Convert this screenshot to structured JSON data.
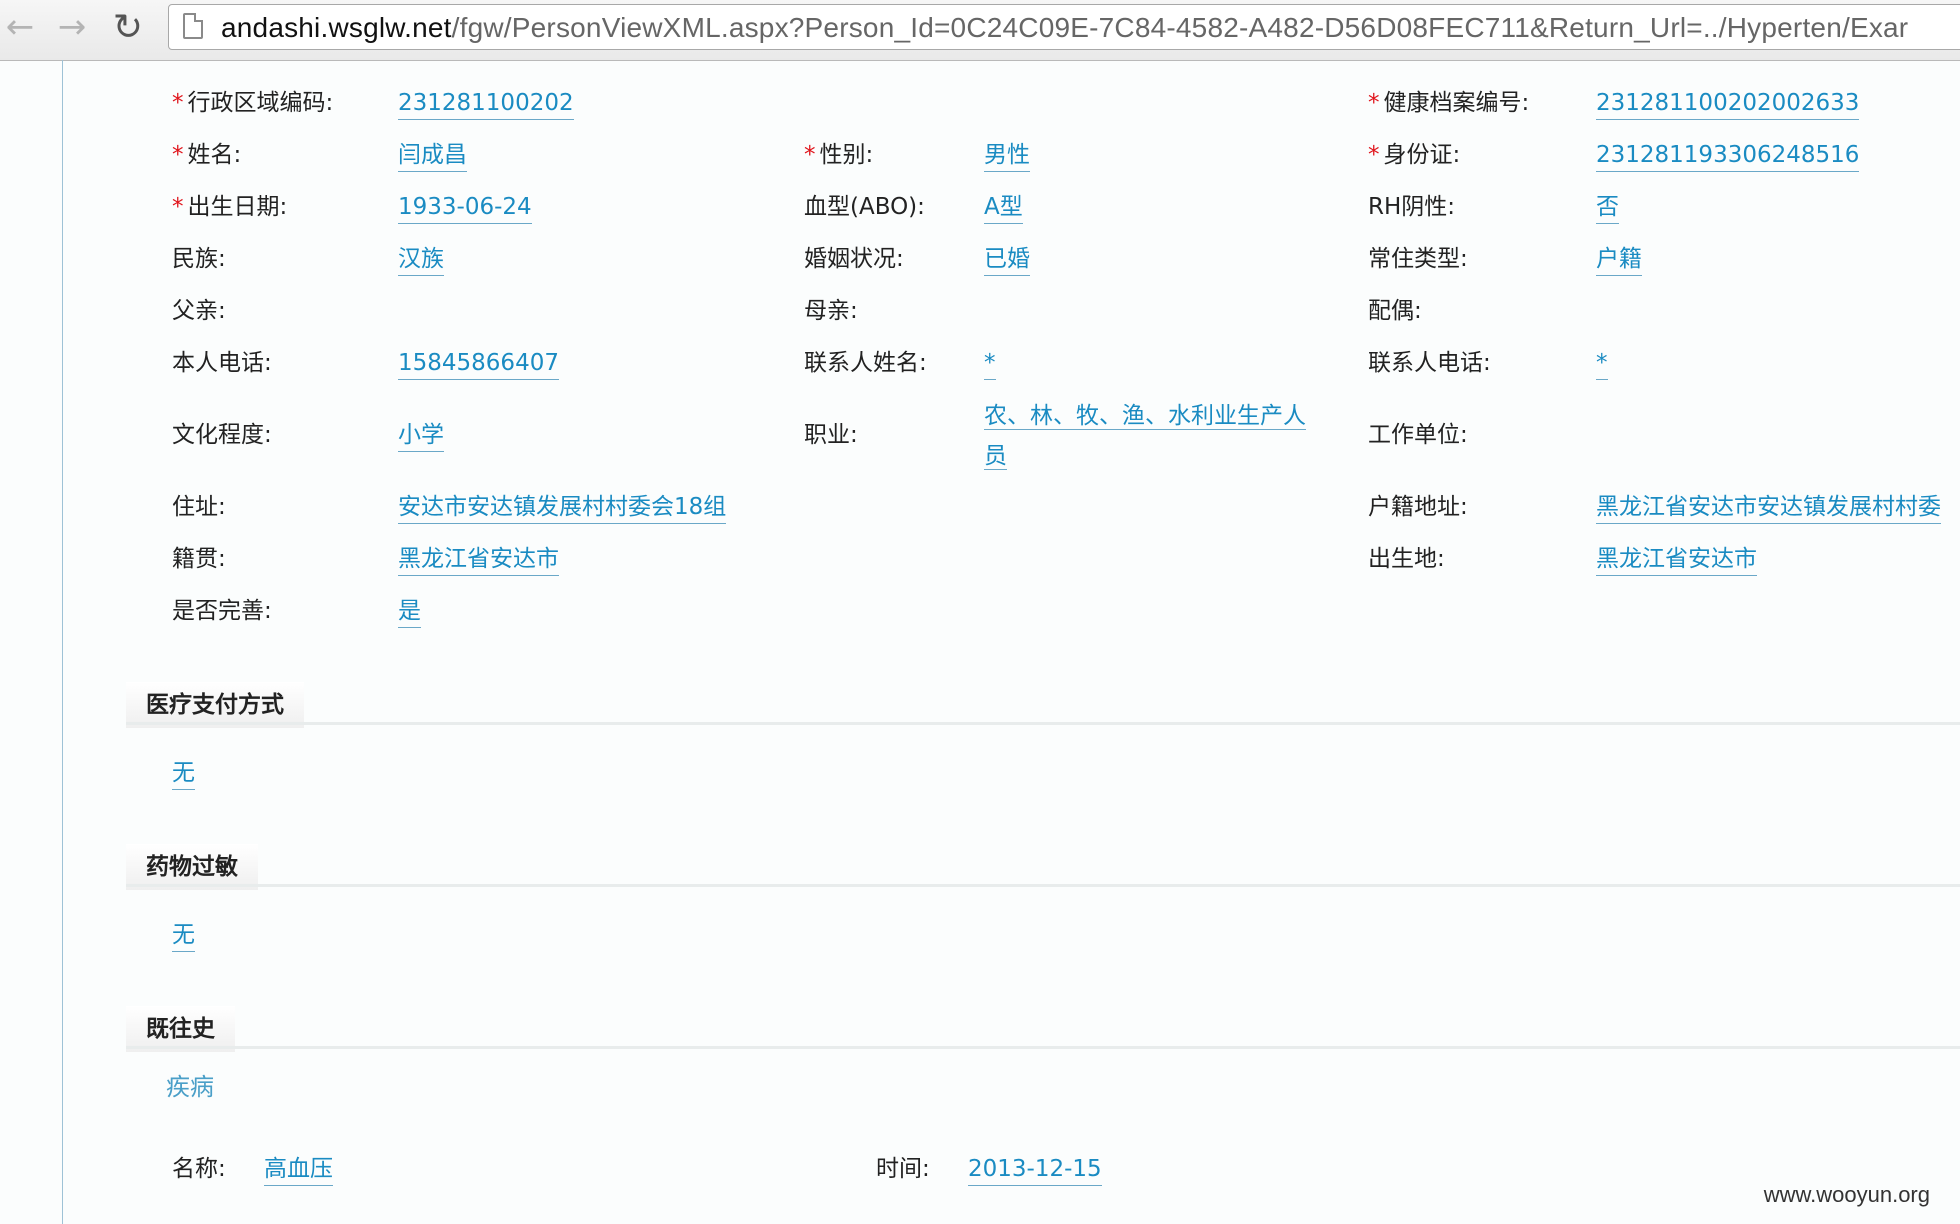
{
  "browser": {
    "url_host": "andashi.wsglw.net",
    "url_path": "/fgw/PersonViewXML.aspx?Person_Id=0C24C09E-7C84-4582-A482-D56D08FEC711&Return_Url=../Hyperten/Exar"
  },
  "person": {
    "region_code_label": "行政区域编码:",
    "region_code": "231281100202",
    "health_record_label": "健康档案编号:",
    "health_record": "231281100202002633",
    "name_label": "姓名:",
    "name": "闫成昌",
    "gender_label": "性别:",
    "gender": "男性",
    "id_card_label": "身份证:",
    "id_card": "231281193306248516",
    "birth_label": "出生日期:",
    "birth": "1933-06-24",
    "blood_label": "血型(ABO):",
    "blood": "A型",
    "rh_label": "RH阴性:",
    "rh": "否",
    "ethnic_label": "民族:",
    "ethnic": "汉族",
    "marital_label": "婚姻状况:",
    "marital": "已婚",
    "residence_type_label": "常住类型:",
    "residence_type": "户籍",
    "father_label": "父亲:",
    "mother_label": "母亲:",
    "spouse_label": "配偶:",
    "phone_label": "本人电话:",
    "phone": "15845866407",
    "contact_name_label": "联系人姓名:",
    "contact_name": "*",
    "contact_phone_label": "联系人电话:",
    "contact_phone": "*",
    "education_label": "文化程度:",
    "education": "小学",
    "occupation_label": "职业:",
    "occupation": "农、林、牧、渔、水利业生产人员",
    "workplace_label": "工作单位:",
    "address_label": "住址:",
    "address": "安达市安达镇发展村村委会18组",
    "household_address_label": "户籍地址:",
    "household_address": "黑龙江省安达市安达镇发展村村委",
    "native_place_label": "籍贯:",
    "native_place": "黑龙江省安达市",
    "birthplace_label": "出生地:",
    "birthplace": "黑龙江省安达市",
    "complete_label": "是否完善:",
    "complete": "是"
  },
  "sections": {
    "payment_title": "医疗支付方式",
    "payment_value": "无",
    "allergy_title": "药物过敏",
    "allergy_value": "无",
    "history_title": "既往史",
    "history_sub": "疾病",
    "disease_name_label": "名称:",
    "disease_name": "高血压",
    "disease_time_label": "时间:",
    "disease_time": "2013-12-15"
  },
  "watermark": "www.wooyun.org",
  "colors": {
    "link": "#1a8bc2",
    "required": "#e0141b"
  }
}
